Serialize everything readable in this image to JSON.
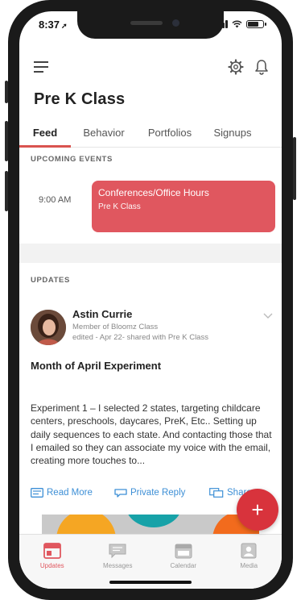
{
  "status_bar": {
    "time": "8:37",
    "location_arrow": "➚",
    "icons": [
      "signal-icon",
      "wifi-icon",
      "battery-icon"
    ]
  },
  "app_bar": {
    "icons": [
      "menu-icon",
      "gear-icon",
      "bell-icon"
    ]
  },
  "page": {
    "title": "Pre K Class"
  },
  "tabs": [
    {
      "label": "Feed",
      "active": true
    },
    {
      "label": "Behavior",
      "active": false
    },
    {
      "label": "Portfolios",
      "active": false
    },
    {
      "label": "Signups",
      "active": false
    }
  ],
  "upcoming": {
    "section_label": "UPCOMING EVENTS",
    "event": {
      "time": "9:00 AM",
      "title": "Conferences/Office Hours",
      "subtitle": "Pre K Class"
    }
  },
  "updates": {
    "section_label": "UPDATES",
    "post": {
      "author": "Astin Currie",
      "role": "Member of Bloomz Class",
      "meta": "edited - Apr 22- shared with Pre K Class",
      "title": "Month of April Experiment",
      "body": "Experiment 1 – I selected 2 states, targeting childcare centers, preschools, daycares, PreK, Etc.. Setting up daily sequences to each state. And contacting those that I emailed so they can associate my voice with the email, creating more touches to...",
      "actions": [
        "Read More",
        "Private Reply",
        "Share"
      ]
    }
  },
  "fab": {
    "label": "+"
  },
  "bottom_nav": [
    {
      "label": "Updates",
      "icon": "updates-icon",
      "active": true
    },
    {
      "label": "Messages",
      "icon": "messages-icon",
      "active": false
    },
    {
      "label": "Calendar",
      "icon": "calendar-icon",
      "active": false
    },
    {
      "label": "Media",
      "icon": "media-icon",
      "active": false
    }
  ],
  "colors": {
    "accent": "#e0575f",
    "fab": "#d8333c",
    "link": "#3d8fd6",
    "text": "#222222"
  }
}
